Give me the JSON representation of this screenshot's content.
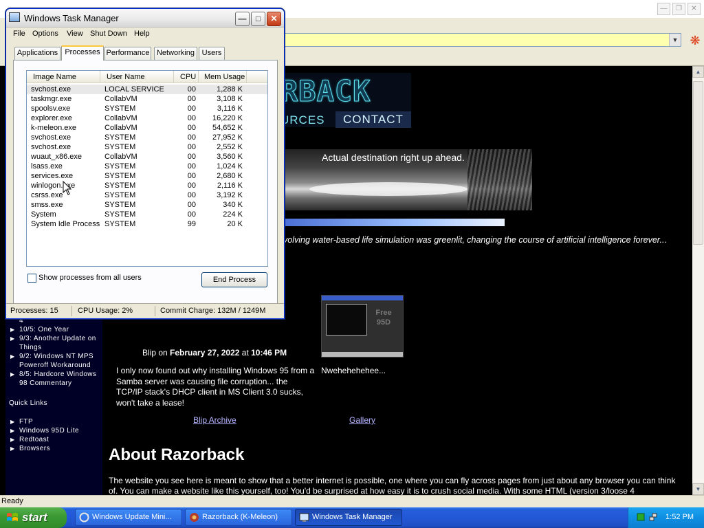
{
  "browser": {
    "status": "Ready",
    "page": {
      "nav_resources": "URCES",
      "nav_contact": "CONTACT",
      "hero_caption": "Actual destination right up ahead.",
      "tagline": "volving water-based life simulation was greenlit, changing the course of artificial intelligence forever...",
      "blip": {
        "prefix": "Blip on ",
        "date": "February 27, 2022",
        "at": " at ",
        "time": "10:46 PM",
        "text": "I only now found out why installing Windows 95 from a Samba server was causing file corruption... the TCP/IP stack's DHCP client in MS Client 3.0 sucks, won't take a lease!"
      },
      "gallery_caption": "Nwehehehehee...",
      "blip_archive_link": "Blip Archive",
      "gallery_link": "Gallery",
      "about_heading": "About Razorback",
      "about_text": "The website you see here is meant to show that a better internet is possible, one where you can fly across pages from just about any browser you can think of. You can make a website like this yourself, too! You'd be surprised at how easy it is to crush social media. With some HTML (version 3/loose 4",
      "sidebar": {
        "fragment": "4",
        "updates": [
          "10/5: One Year",
          "9/3: Another Update on Things",
          "9/2: Windows NT MPS Poweroff Workaround",
          "8/5: Hardcore Windows 98 Commentary"
        ],
        "quick_links_heading": "Quick Links",
        "quick_links": [
          "FTP",
          "Windows 95D Lite",
          "Redtoast",
          "Browsers"
        ]
      }
    }
  },
  "taskmgr": {
    "title": "Windows Task Manager",
    "menu": [
      "File",
      "Options",
      "View",
      "Shut Down",
      "Help"
    ],
    "tabs": [
      "Applications",
      "Processes",
      "Performance",
      "Networking",
      "Users"
    ],
    "active_tab": "Processes",
    "columns": [
      "Image Name",
      "User Name",
      "CPU",
      "Mem Usage"
    ],
    "processes": [
      {
        "name": "svchost.exe",
        "user": "LOCAL SERVICE",
        "cpu": "00",
        "mem": "1,288 K"
      },
      {
        "name": "taskmgr.exe",
        "user": "CollabVM",
        "cpu": "00",
        "mem": "3,108 K"
      },
      {
        "name": "spoolsv.exe",
        "user": "SYSTEM",
        "cpu": "00",
        "mem": "3,116 K"
      },
      {
        "name": "explorer.exe",
        "user": "CollabVM",
        "cpu": "00",
        "mem": "16,220 K"
      },
      {
        "name": "k-meleon.exe",
        "user": "CollabVM",
        "cpu": "00",
        "mem": "54,652 K"
      },
      {
        "name": "svchost.exe",
        "user": "SYSTEM",
        "cpu": "00",
        "mem": "27,952 K"
      },
      {
        "name": "svchost.exe",
        "user": "SYSTEM",
        "cpu": "00",
        "mem": "2,552 K"
      },
      {
        "name": "wuaut_x86.exe",
        "user": "CollabVM",
        "cpu": "00",
        "mem": "3,560 K"
      },
      {
        "name": "lsass.exe",
        "user": "SYSTEM",
        "cpu": "00",
        "mem": "1,024 K"
      },
      {
        "name": "services.exe",
        "user": "SYSTEM",
        "cpu": "00",
        "mem": "2,680 K"
      },
      {
        "name": "winlogon.exe",
        "user": "SYSTEM",
        "cpu": "00",
        "mem": "2,116 K"
      },
      {
        "name": "csrss.exe",
        "user": "SYSTEM",
        "cpu": "00",
        "mem": "3,192 K"
      },
      {
        "name": "smss.exe",
        "user": "SYSTEM",
        "cpu": "00",
        "mem": "340 K"
      },
      {
        "name": "System",
        "user": "SYSTEM",
        "cpu": "00",
        "mem": "224 K"
      },
      {
        "name": "System Idle Process",
        "user": "SYSTEM",
        "cpu": "99",
        "mem": "20 K"
      }
    ],
    "show_all_label": "Show processes from all users",
    "end_process_label": "End Process",
    "status": {
      "processes": "Processes: 15",
      "cpu": "CPU Usage: 2%",
      "commit": "Commit Charge: 132M / 1249M"
    }
  },
  "taskbar": {
    "start_label": "start",
    "buttons": [
      {
        "label": "Windows Update Mini...",
        "icon": "windows-update-icon"
      },
      {
        "label": "Razorback (K-Meleon)",
        "icon": "k-meleon-icon"
      },
      {
        "label": "Windows Task Manager",
        "icon": "task-manager-icon",
        "active": true
      }
    ],
    "clock": "1:52 PM"
  }
}
